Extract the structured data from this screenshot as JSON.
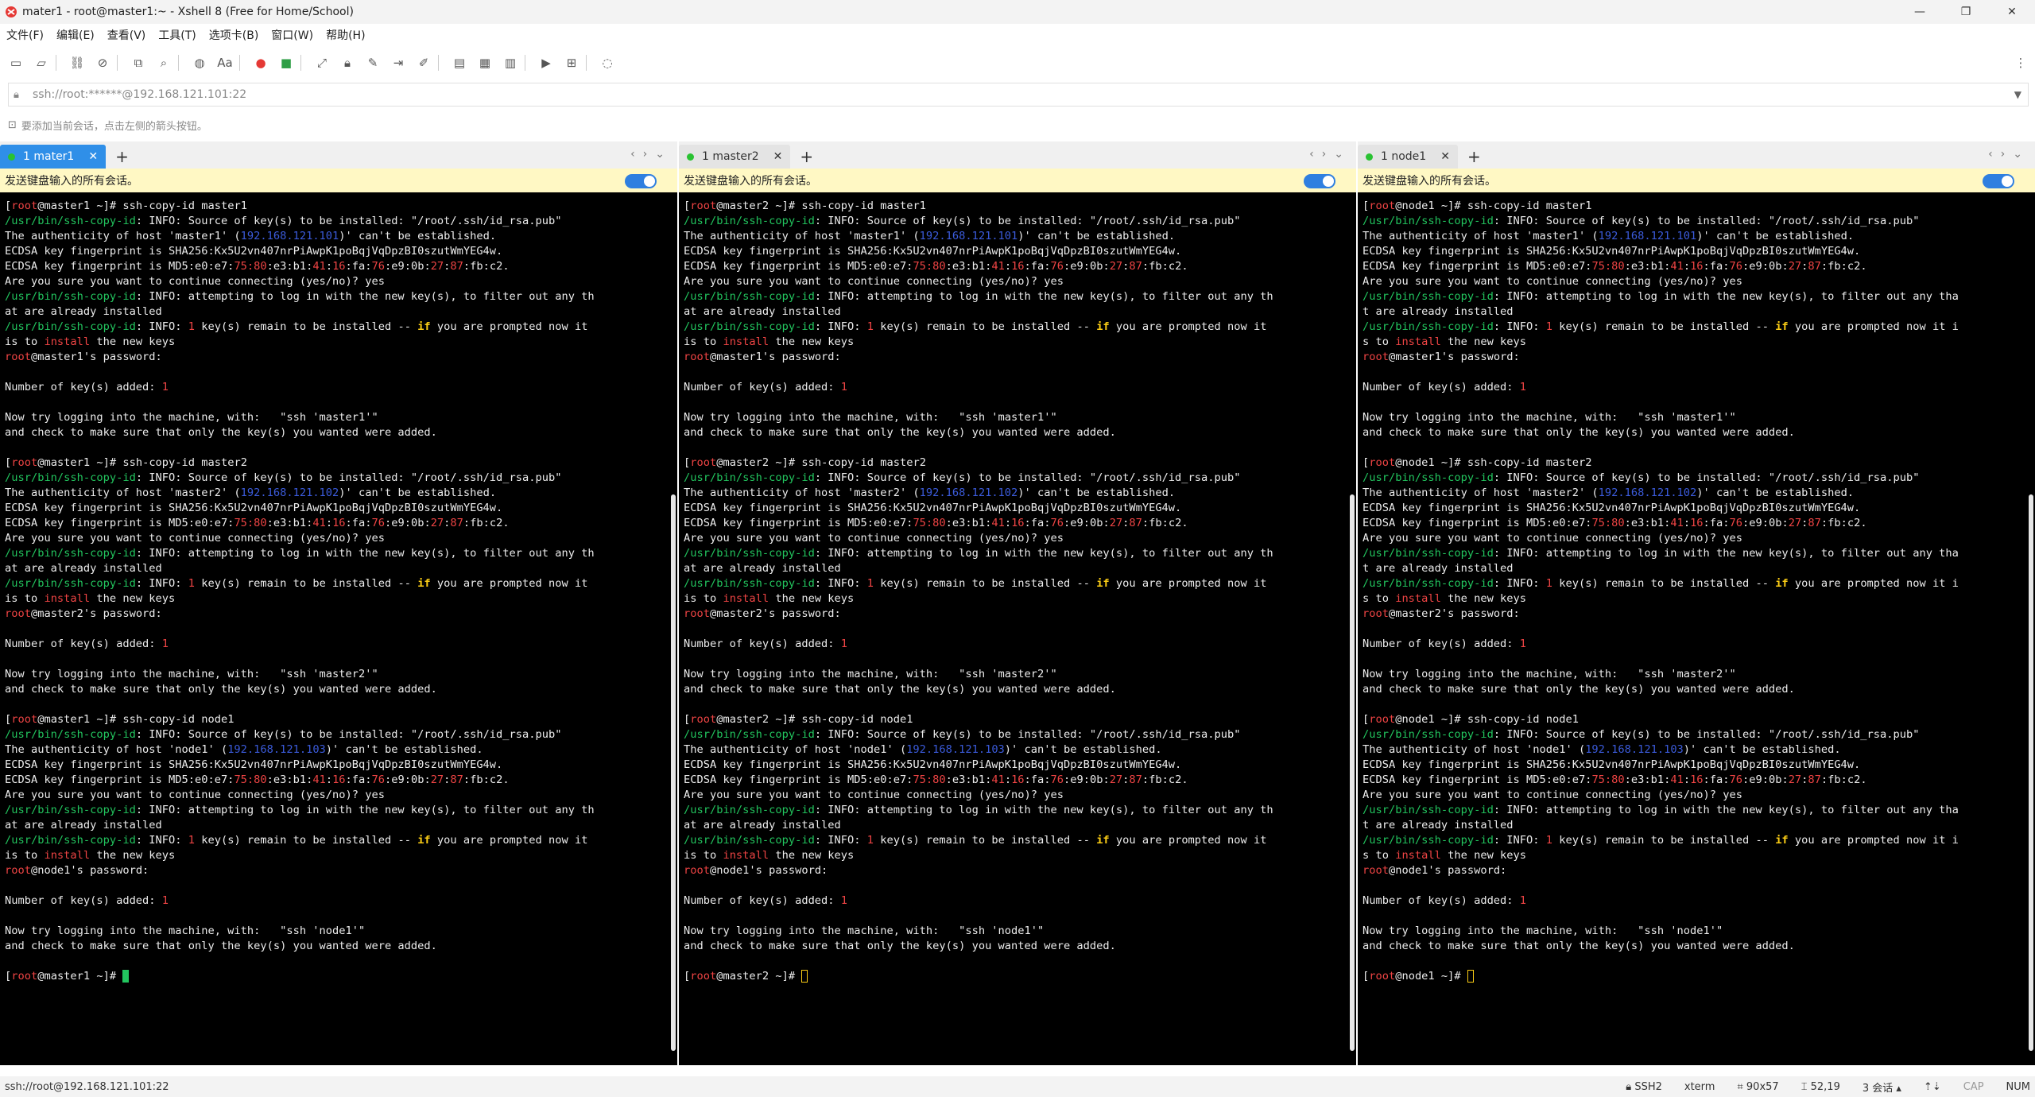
{
  "window": {
    "title": "mater1 - root@master1:~ - Xshell 8 (Free for Home/School)"
  },
  "menu": [
    "文件(F)",
    "编辑(E)",
    "查看(V)",
    "工具(T)",
    "选项卡(B)",
    "窗口(W)",
    "帮助(H)"
  ],
  "address": {
    "text": "ssh://root:******@192.168.121.101:22"
  },
  "hint": {
    "text": "要添加当前会话，点击左侧的箭头按钮。"
  },
  "send_bar": {
    "label": "发送键盘输入的所有会话。"
  },
  "panes": [
    {
      "tab_label": "1 mater1",
      "active": true,
      "hosts": {
        "master1": "192.168.121.101",
        "master2": "192.168.121.102",
        "node1": "192.168.121.103"
      },
      "prompt_host": "master1",
      "wrap": 0
    },
    {
      "tab_label": "1 master2",
      "active": false,
      "hosts": {
        "master1": "192.168.121.101",
        "master2": "192.168.121.102",
        "node1": "192.168.121.103"
      },
      "prompt_host": "master2",
      "wrap": 0
    },
    {
      "tab_label": "1 node1",
      "active": false,
      "hosts": {
        "master1": "192.168.121.101",
        "master2": "192.168.121.102",
        "node1": "192.168.121.103"
      },
      "prompt_host": "node1",
      "wrap": 1
    }
  ],
  "terminal_text": {
    "info_source": "INFO: Source of key(s) to be installed: \"/root/.ssh/id_rsa.pub\"",
    "authenticity_pre": "The authenticity of host '",
    "authenticity_post": ")' can't be established.",
    "sha256": "ECDSA key fingerprint is SHA256:Kx5U2vn407nrPiAwpK1poBqjVqDpzBI0szutWmYEG4w.",
    "md5_pre": "ECDSA key fingerprint is MD5:",
    "md5_segments": [
      "e0:e7:",
      "75:80",
      ":e3:b1:",
      "41",
      ":",
      "16",
      ":fa:",
      "76",
      ":e9:0b:",
      "27",
      ":",
      "87",
      ":fb:c2."
    ],
    "continue_q": "Are you sure you want to continue connecting (yes/no)? yes",
    "attempting_a": "INFO: attempting to log in with the new key(s), to filter out any th",
    "attempting_b": "at are already installed",
    "remain_a": " key(s) remain to be installed -- ",
    "remain_b": " you are prompted now it",
    "remain_c": "is to ",
    "remain_d": " the new keys",
    "password_suffix": "'s password:",
    "added": "Number of key(s) added: ",
    "try_login": "Now try logging into the machine, with:   \"ssh '",
    "check": "and check to make sure that only the key(s) you wanted were added.",
    "cmd": "ssh-copy-id",
    "binpath": "/usr/bin/ssh-copy-id",
    "root": "root",
    "if": "if",
    "install": "install",
    "one": "1"
  },
  "status": {
    "left": "ssh://root@192.168.121.101:22",
    "protocol": "SSH2",
    "term": "xterm",
    "size": "90x57",
    "cursor": "52,19",
    "sessions": "3 会话",
    "cap": "CAP",
    "num": "NUM"
  }
}
